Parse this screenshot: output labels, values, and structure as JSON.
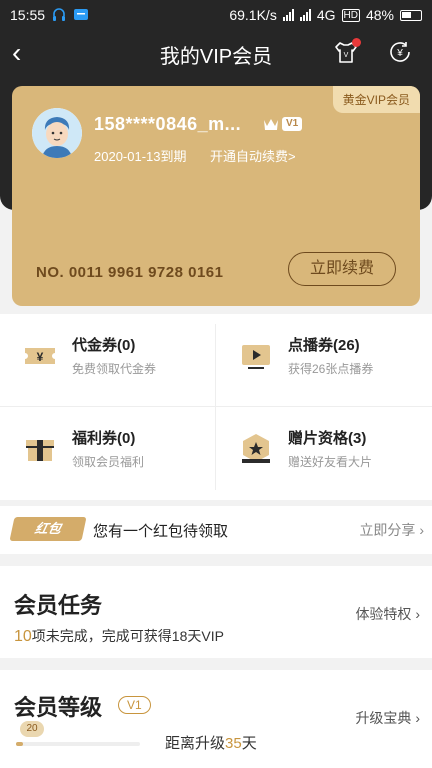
{
  "status_bar": {
    "time": "15:55",
    "speed": "69.1K/s",
    "network": "4G",
    "hd": "HD",
    "battery": "48%"
  },
  "nav": {
    "back": "‹",
    "title": "我的VIP会员"
  },
  "card": {
    "badge": "黄金VIP会员",
    "username": "158****0846_m...",
    "level_tag": "V1",
    "expire": "2020-01-13到期",
    "auto_renew": "开通自动续费>",
    "card_no": "NO. 0011 9961 9728 0161",
    "renew_button": "立即续费",
    "card_color": "#d9b77a"
  },
  "benefits": [
    {
      "title": "代金券(0)",
      "subtitle": "免费领取代金券",
      "icon": "voucher-icon"
    },
    {
      "title": "点播券(26)",
      "subtitle": "获得26张点播券",
      "icon": "play-ticket-icon"
    },
    {
      "title": "福利券(0)",
      "subtitle": "领取会员福利",
      "icon": "gift-box-icon"
    },
    {
      "title": "赠片资格(3)",
      "subtitle": "赠送好友看大片",
      "icon": "gift-movie-icon"
    }
  ],
  "redpacket": {
    "tag": "红包",
    "text": "您有一个红包待领取",
    "action": "立即分享"
  },
  "tasks": {
    "title": "会员任务",
    "count": "10",
    "subtitle": "项未完成，完成可获得18天VIP",
    "action": "体验特权"
  },
  "level": {
    "title": "会员等级",
    "tag": "V1",
    "points": "20",
    "progress_fraction": 0.06,
    "dist_prefix": "距离升级",
    "dist_days": "35",
    "dist_suffix": "天",
    "action": "升级宝典",
    "accent": "#c8953e"
  }
}
